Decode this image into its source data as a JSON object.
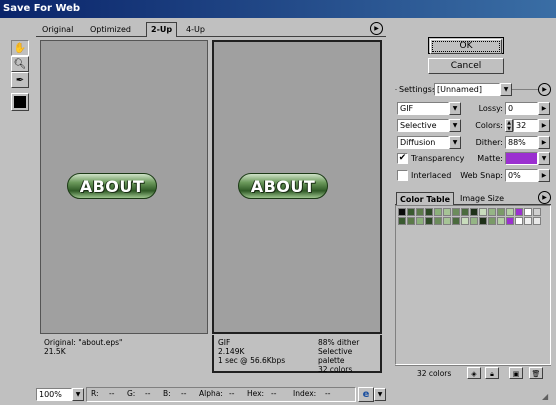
{
  "window": {
    "title": "Save For Web"
  },
  "tabs": [
    {
      "label": "Original"
    },
    {
      "label": "Optimized"
    },
    {
      "label": "2-Up"
    },
    {
      "label": "4-Up"
    }
  ],
  "left_pane": {
    "image_text": "ABOUT",
    "info_line1": "Original: \"about.eps\"",
    "info_line2": "21.5K"
  },
  "right_pane": {
    "image_text": "ABOUT",
    "info_left1": "GIF",
    "info_left2": "2.149K",
    "info_left3": "1 sec @ 56.6Kbps",
    "info_right1": "88% dither",
    "info_right2": "Selective palette",
    "info_right3": "32 colors"
  },
  "buttons": {
    "ok": "OK",
    "cancel": "Cancel"
  },
  "settings": {
    "label": "Settings:",
    "preset": "[Unnamed]",
    "format": "GIF",
    "lossy_label": "Lossy:",
    "lossy": "0",
    "palette": "Selective",
    "colors_label": "Colors:",
    "colors": "32",
    "dither_alg": "Diffusion",
    "dither_label": "Dither:",
    "dither": "88%",
    "transparency_label": "Transparency",
    "transparency_checked": true,
    "matte_label": "Matte:",
    "matte_color": "#9b30d0",
    "interlaced_label": "Interlaced",
    "interlaced_checked": false,
    "websnap_label": "Web Snap:",
    "websnap": "0%"
  },
  "color_panel": {
    "tab_color_table": "Color Table",
    "tab_image_size": "Image Size",
    "count": "32 colors"
  },
  "status": {
    "zoom": "100%",
    "r": "R:",
    "r_val": "--",
    "g": "G:",
    "g_val": "--",
    "b": "B:",
    "b_val": "--",
    "alpha": "Alpha:",
    "alpha_val": "--",
    "hex": "Hex:",
    "hex_val": "--",
    "index": "Index:",
    "index_val": "--"
  },
  "colors": {
    "swatches": [
      "#0a0a0a",
      "#3a5a30",
      "#5c7a4a",
      "#2e4a26",
      "#8bb07a",
      "#a6c496",
      "#6c8c5c",
      "#4b6b3e",
      "#1e3018",
      "#c8dcbc",
      "#95b585",
      "#7a9a68",
      "#b5cfa5",
      "#9b30d0",
      "#ffffff",
      "#d0d0d0",
      "#3a5a30",
      "#5c7a4a",
      "#8bb07a",
      "#2e4a26",
      "#6c8c5c",
      "#a6c496",
      "#4b6b3e",
      "#c8dcbc",
      "#95b585",
      "#1e3018",
      "#7a9a68",
      "#b5cfa5",
      "#9b30d0",
      "#ffffff",
      "#f0f0f0",
      "#e8e8e8"
    ]
  }
}
